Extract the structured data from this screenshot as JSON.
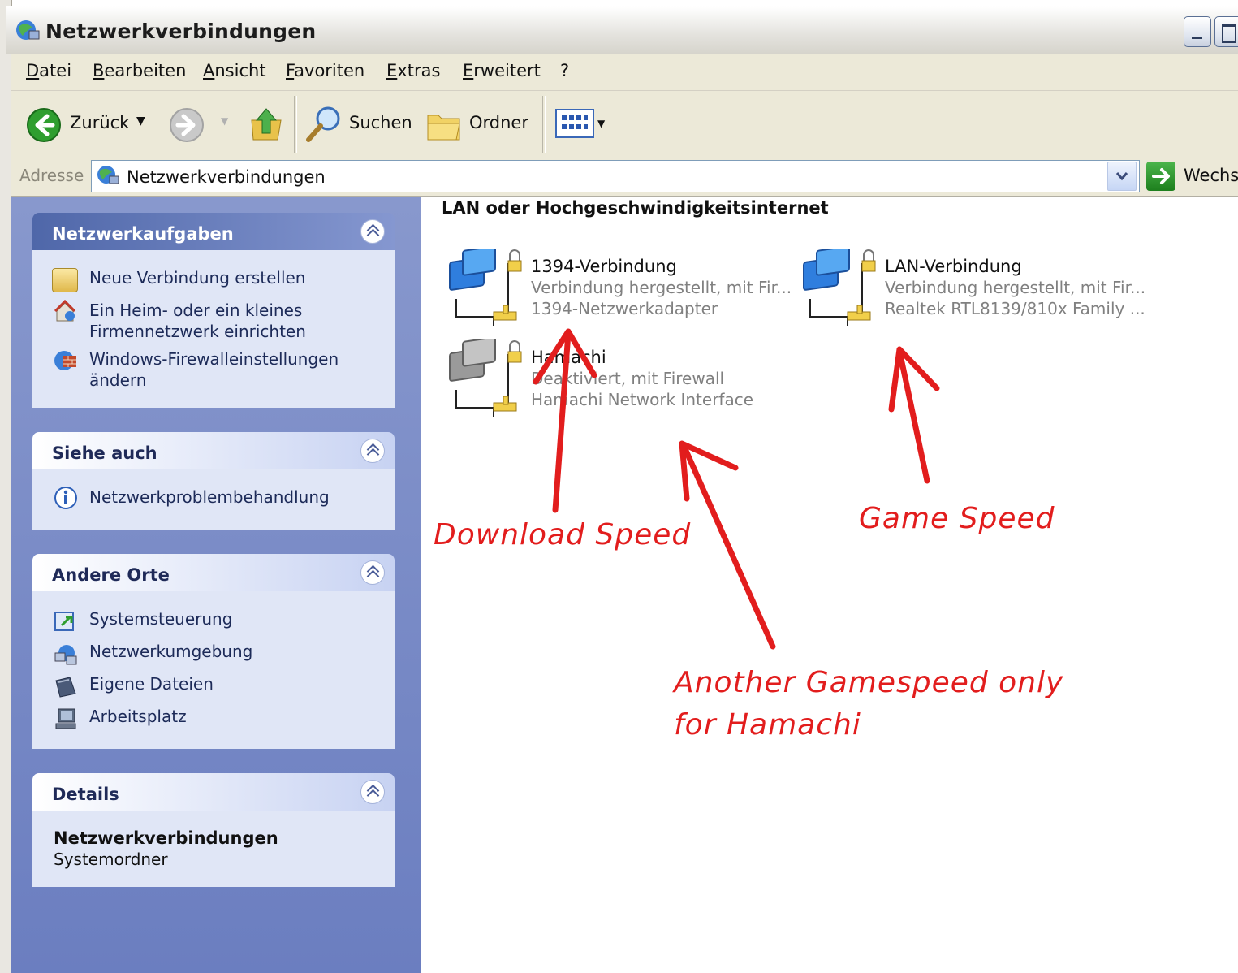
{
  "window": {
    "title": "Netzwerkverbindungen"
  },
  "menubar": {
    "items": [
      "Datei",
      "Bearbeiten",
      "Ansicht",
      "Favoriten",
      "Extras",
      "Erweitert",
      "?"
    ]
  },
  "toolbar": {
    "back_label": "Zurück",
    "search_label": "Suchen",
    "folders_label": "Ordner"
  },
  "addressbar": {
    "label": "Adresse",
    "value": "Netzwerkverbindungen",
    "go_label": "Wechs"
  },
  "sidebar": {
    "panels": [
      {
        "title": "Netzwerkaufgaben",
        "items": [
          {
            "label": "Neue Verbindung erstellen",
            "icon": "new-connection-icon"
          },
          {
            "label": "Ein Heim- oder ein kleines Firmennetzwerk einrichten",
            "icon": "home-network-icon"
          },
          {
            "label": "Windows-Firewalleinstellungen ändern",
            "icon": "firewall-icon"
          }
        ]
      },
      {
        "title": "Siehe auch",
        "items": [
          {
            "label": "Netzwerkproblembehandlung",
            "icon": "info-icon"
          }
        ]
      },
      {
        "title": "Andere Orte",
        "items": [
          {
            "label": "Systemsteuerung",
            "icon": "control-panel-icon"
          },
          {
            "label": "Netzwerkumgebung",
            "icon": "network-places-icon"
          },
          {
            "label": "Eigene Dateien",
            "icon": "my-documents-icon"
          },
          {
            "label": "Arbeitsplatz",
            "icon": "my-computer-icon"
          }
        ]
      },
      {
        "title": "Details",
        "detail_name": "Netzwerkverbindungen",
        "detail_type": "Systemordner"
      }
    ]
  },
  "content": {
    "group_header": "LAN oder Hochgeschwindigkeitsinternet",
    "connections": [
      {
        "name": "1394-Verbindung",
        "status": "Verbindung hergestellt, mit Fir...",
        "device": "1394-Netzwerkadapter",
        "enabled": true
      },
      {
        "name": "LAN-Verbindung",
        "status": "Verbindung hergestellt, mit Fir...",
        "device": "Realtek RTL8139/810x Family ...",
        "enabled": true
      },
      {
        "name": "Hamachi",
        "status": "Deaktiviert, mit Firewall",
        "device": "Hamachi Network Interface",
        "enabled": false
      }
    ]
  },
  "annotations": {
    "download": "Download Speed",
    "game": "Game Speed",
    "another_line1": "Another Gamespeed only",
    "another_line2": "for Hamachi",
    "color": "#e21d1d"
  }
}
